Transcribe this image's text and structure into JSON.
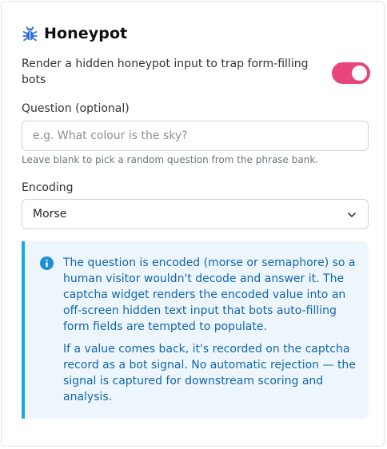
{
  "header": {
    "title": "Honeypot",
    "icon": "bug-icon"
  },
  "toggle": {
    "label": "Render a hidden honeypot input to trap form-filling bots",
    "on": true,
    "color": "#e8457a"
  },
  "question": {
    "label": "Question (optional)",
    "placeholder": "e.g. What colour is the sky?",
    "value": "",
    "help": "Leave blank to pick a random question from the phrase bank."
  },
  "encoding": {
    "label": "Encoding",
    "value": "Morse"
  },
  "info": {
    "icon": "info-icon",
    "accent": "#1ca6e6",
    "para1": "The question is encoded (morse or semaphore) so a human visitor wouldn't decode and answer it. The captcha widget renders the encoded value into an off-screen hidden text input that bots auto-filling form fields are tempted to populate.",
    "para2": "If a value comes back, it's recorded on the captcha record as a bot signal. No automatic rejection — the signal is captured for downstream scoring and analysis."
  }
}
